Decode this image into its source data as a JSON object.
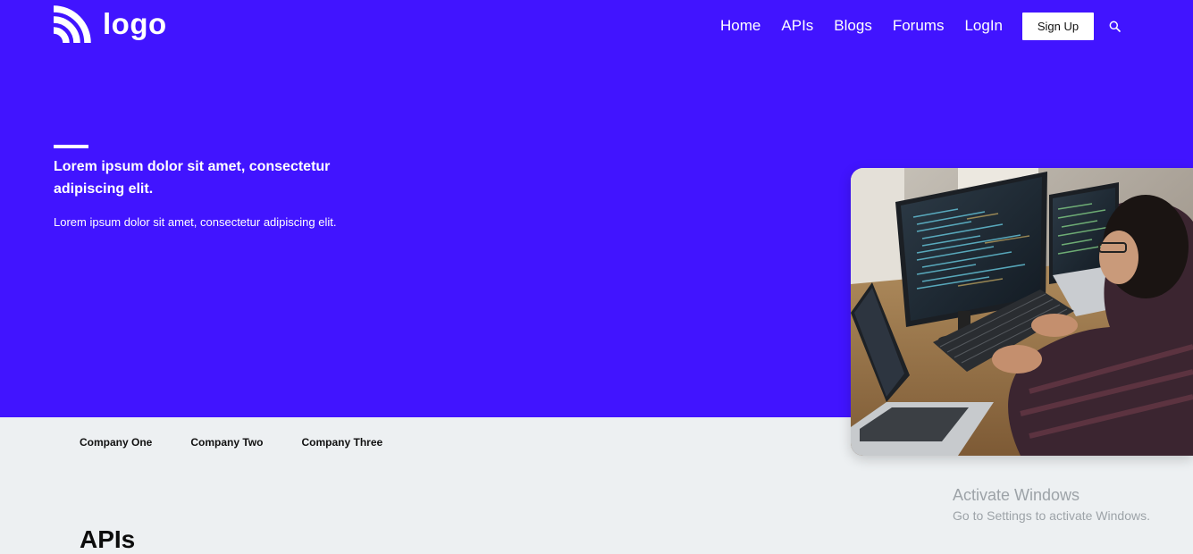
{
  "header": {
    "logo_text": "logo",
    "nav": {
      "home": "Home",
      "apis": "APIs",
      "blogs": "Blogs",
      "forums": "Forums",
      "login": "LogIn"
    },
    "signup_label": "Sign Up",
    "search_icon": "search-icon"
  },
  "hero": {
    "title": "Lorem ipsum dolor sit amet, consectetur adipiscing elit.",
    "subtitle": "Lorem ipsum dolor sit amet, consectetur adipiscing elit.",
    "image_icon": "developer-workspace-photo"
  },
  "companies": [
    "Company One",
    "Company Two",
    "Company Three"
  ],
  "sections": {
    "apis_title": "APIs"
  },
  "watermark": {
    "title": "Activate Windows",
    "subtitle": "Go to Settings to activate Windows."
  },
  "colors": {
    "brand": "#4114ff",
    "page_background": "#edf0f2",
    "text_on_brand": "#ffffff"
  }
}
